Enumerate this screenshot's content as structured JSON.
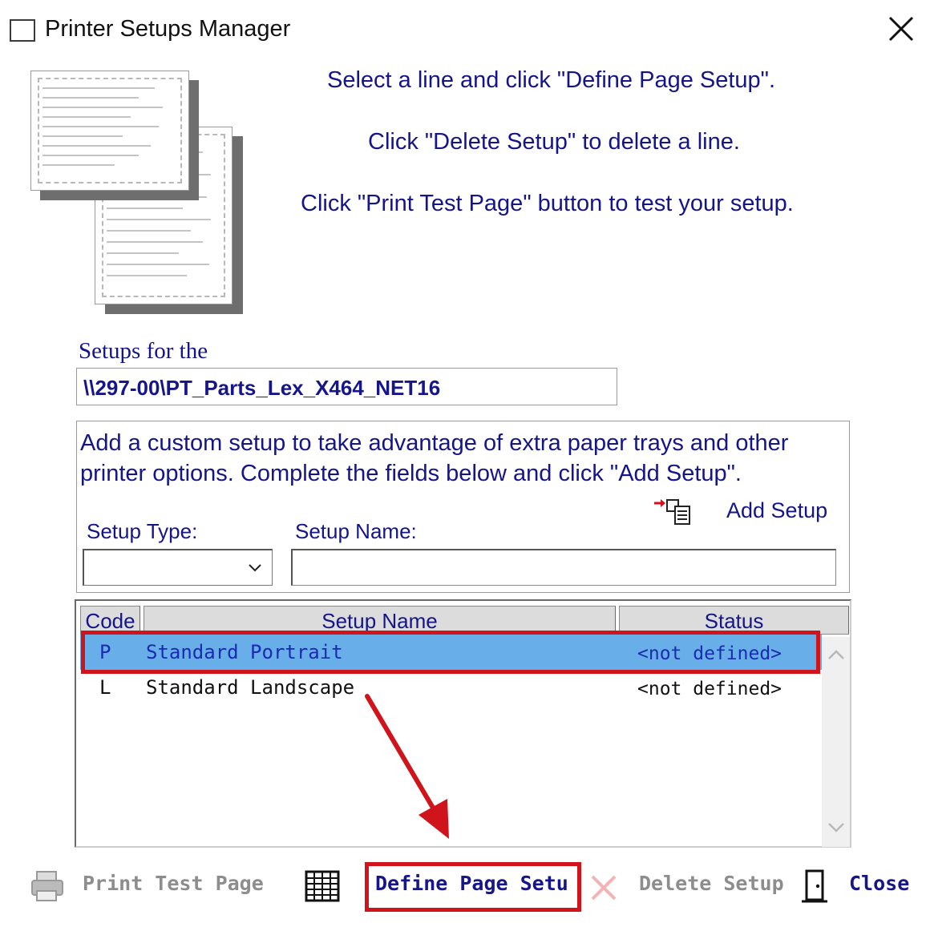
{
  "window": {
    "title": "Printer Setups Manager",
    "icons": [
      "window-icon",
      "close-icon"
    ]
  },
  "instructions": [
    "Select a line and click \"Define Page Setup\".",
    "Click \"Delete Setup\" to delete a line.",
    "Click  \"Print Test Page\" button to test your setup."
  ],
  "setups_for": {
    "label": "Setups for the",
    "printer": "\\\\297-00\\PT_Parts_Lex_X464_NET16"
  },
  "custom_setup": {
    "description": "Add a custom setup to take advantage of extra paper trays and other printer options. Complete the fields below and click \"Add Setup\".",
    "add_label": "Add Setup",
    "type_label": "Setup Type:",
    "name_label": "Setup Name:",
    "type_value": "",
    "name_value": ""
  },
  "table": {
    "columns": [
      "Code",
      "Setup Name",
      "Status"
    ],
    "rows": [
      {
        "code": "P",
        "name": "Standard Portrait",
        "status": "<not defined>",
        "selected": true
      },
      {
        "code": "L",
        "name": "Standard Landscape",
        "status": "<not defined>",
        "selected": false
      }
    ]
  },
  "toolbar": {
    "print_test": "Print Test Page",
    "define": "Define Page Setu",
    "delete": "Delete Setup",
    "close": "Close"
  },
  "colors": {
    "label_text": "#151589",
    "selection": "#68aee9",
    "highlight": "#d0141b",
    "disabled": "#8d8d8d"
  }
}
